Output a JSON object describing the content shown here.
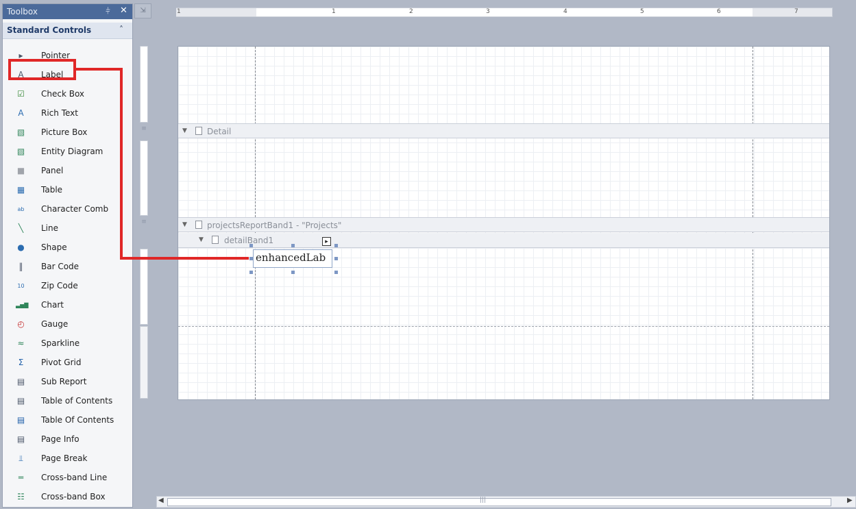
{
  "toolbox": {
    "title": "Toolbox",
    "pin_glyph": "⫩",
    "close_glyph": "✕",
    "group_label": "Standard Controls",
    "group_chevron": "˄",
    "items": [
      {
        "label": "Pointer",
        "icon": "pointer-icon",
        "glyph": "▸",
        "color": "#4a5568"
      },
      {
        "label": "Label",
        "icon": "label-icon",
        "glyph": "A",
        "color": "#4a5568"
      },
      {
        "label": "Check Box",
        "icon": "checkbox-icon",
        "glyph": "☑",
        "color": "#3a8a3a"
      },
      {
        "label": "Rich Text",
        "icon": "rich-text-icon",
        "glyph": "A",
        "color": "#2b6cb0"
      },
      {
        "label": "Picture Box",
        "icon": "picture-box-icon",
        "glyph": "▧",
        "color": "#2f855a"
      },
      {
        "label": "Entity Diagram",
        "icon": "entity-diagram-icon",
        "glyph": "▧",
        "color": "#2f855a"
      },
      {
        "label": "Panel",
        "icon": "panel-icon",
        "glyph": "■",
        "color": "#a0a4ab"
      },
      {
        "label": "Table",
        "icon": "table-icon",
        "glyph": "▦",
        "color": "#2b6cb0"
      },
      {
        "label": "Character Comb",
        "icon": "character-comb-icon",
        "glyph": "ab",
        "color": "#2b6cb0"
      },
      {
        "label": "Line",
        "icon": "line-icon",
        "glyph": "╲",
        "color": "#2f855a"
      },
      {
        "label": "Shape",
        "icon": "shape-icon",
        "glyph": "●",
        "color": "#2b6cb0"
      },
      {
        "label": "Bar Code",
        "icon": "bar-code-icon",
        "glyph": "‖",
        "color": "#4a5568"
      },
      {
        "label": "Zip Code",
        "icon": "zip-code-icon",
        "glyph": "10",
        "color": "#2b6cb0"
      },
      {
        "label": "Chart",
        "icon": "chart-icon",
        "glyph": "▃▅▇",
        "color": "#2f855a"
      },
      {
        "label": "Gauge",
        "icon": "gauge-icon",
        "glyph": "◴",
        "color": "#c53030"
      },
      {
        "label": "Sparkline",
        "icon": "sparkline-icon",
        "glyph": "≈",
        "color": "#2f855a"
      },
      {
        "label": "Pivot Grid",
        "icon": "pivot-grid-icon",
        "glyph": "Σ",
        "color": "#1f5fa8"
      },
      {
        "label": "Sub Report",
        "icon": "sub-report-icon",
        "glyph": "▤",
        "color": "#4a5568"
      },
      {
        "label": "Table of Contents",
        "icon": "table-of-contents-icon",
        "glyph": "▤",
        "color": "#4a5568"
      },
      {
        "label": "Table Of Contents",
        "icon": "table-of-contents-alt-icon",
        "glyph": "▤",
        "color": "#1f5fa8"
      },
      {
        "label": "Page Info",
        "icon": "page-info-icon",
        "glyph": "▤",
        "color": "#4a5568"
      },
      {
        "label": "Page Break",
        "icon": "page-break-icon",
        "glyph": "⫫",
        "color": "#2b6cb0"
      },
      {
        "label": "Cross-band Line",
        "icon": "cross-band-line-icon",
        "glyph": "═",
        "color": "#2f855a"
      },
      {
        "label": "Cross-band Box",
        "icon": "cross-band-box-icon",
        "glyph": "☷",
        "color": "#2f855a"
      }
    ]
  },
  "ruler": {
    "numbers": [
      "1",
      "1",
      "2",
      "3",
      "4",
      "5",
      "6",
      "7"
    ]
  },
  "report": {
    "bands": [
      {
        "label": "Detail"
      },
      {
        "label": "projectsReportBand1 - \"Projects\""
      },
      {
        "label": "detailBand1"
      }
    ],
    "label_control_text": "enhancedLab",
    "smart_tag_glyph": "▸"
  },
  "scrollbar": {
    "grip": "|||",
    "left_arrow": "◀",
    "right_arrow": "▶"
  },
  "colors": {
    "highlight": "#e02727",
    "toolbox_header": "#4b6a9a",
    "workspace": "#b1b8c6"
  }
}
